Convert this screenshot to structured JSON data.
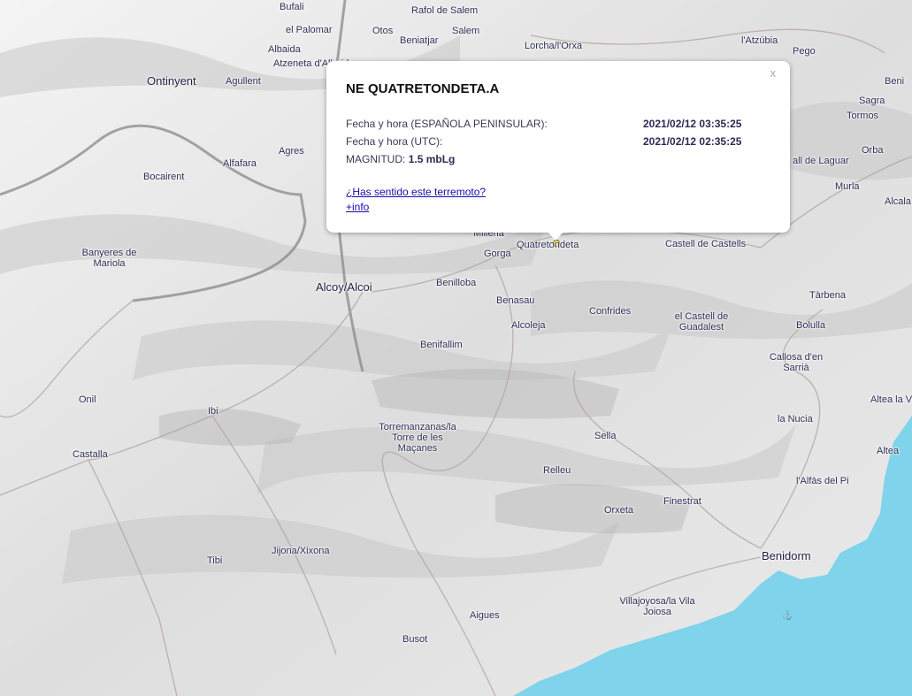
{
  "popup": {
    "title": "NE QUATRETONDETA.A",
    "close": "x",
    "rows": [
      {
        "label": "Fecha y hora (ESPAÑOLA PENINSULAR):",
        "value": "2021/02/12 03:35:25"
      },
      {
        "label": "Fecha y hora (UTC):",
        "value": "2021/02/12 02:35:25"
      }
    ],
    "magnitude_label": "MAGNITUD:",
    "magnitude_value": "1.5 mbLg",
    "felt_link": "¿Has sentido este terremoto?",
    "info_link": "+info"
  },
  "places": {
    "bufali": "Bufali",
    "rafol": "Rafol de Salem",
    "el_palomar": "el Palomar",
    "otos": "Otos",
    "beniatjar": "Beniatjar",
    "salem": "Salem",
    "lorcha": "Lorcha/l'Orxa",
    "atzubia": "l'Atzúbia",
    "pego": "Pego",
    "albaida": "Albaida",
    "atzeneta": "Atzeneta d'Albaida",
    "ontinyent": "Ontinyent",
    "agullent": "Agullent",
    "beni": "Beni",
    "sagra": "Sagra",
    "tormos": "Tormos",
    "orba": "Orba",
    "agres": "Agres",
    "alfafara": "Alfafara",
    "bocairent": "Bocairent",
    "vall_laguar": "all de Laguar",
    "murla": "Murla",
    "alcala": "Alcala",
    "banyeres": "Banyeres de Mariola",
    "millena": "Millena",
    "quatretondeta": "Quatretondeta",
    "castell_castells": "Castell de Castells",
    "gorga": "Gorga",
    "alcoy": "Alcoy/Alcoi",
    "benilloba": "Benilloba",
    "tarbena": "Tàrbena",
    "benasau": "Benasau",
    "confrides": "Confrides",
    "castell_guadalest": "el Castell de Guadalest",
    "alcoleja": "Alcoleja",
    "bolulla": "Bolulla",
    "benifallim": "Benifallim",
    "callosa": "Callosa d'en Sarrià",
    "onil": "Onil",
    "ibi": "Ibi",
    "altea_la_vella": "Altea la V",
    "nucia": "la Nucia",
    "torremanzanas": "Torremanzanas/la Torre de les Maçanes",
    "sella": "Sella",
    "castalla": "Castalla",
    "altea": "Altea",
    "relleu": "Relleu",
    "alfas": "l'Alfàs del Pi",
    "orxeta": "Orxeta",
    "finestrat": "Finestrat",
    "tibi": "Tibi",
    "xixona": "Jijona/Xixona",
    "benidorm": "Benidorm",
    "villajoyosa": "Villajoyosa/la Vila Joiosa",
    "aigues": "Aigues",
    "busot": "Busot"
  },
  "colors": {
    "sea": "#7fd3ea",
    "land": "#e9e9e9",
    "road": "#9a9a9a",
    "marker": "#f4e300",
    "link": "#1a0dab"
  }
}
